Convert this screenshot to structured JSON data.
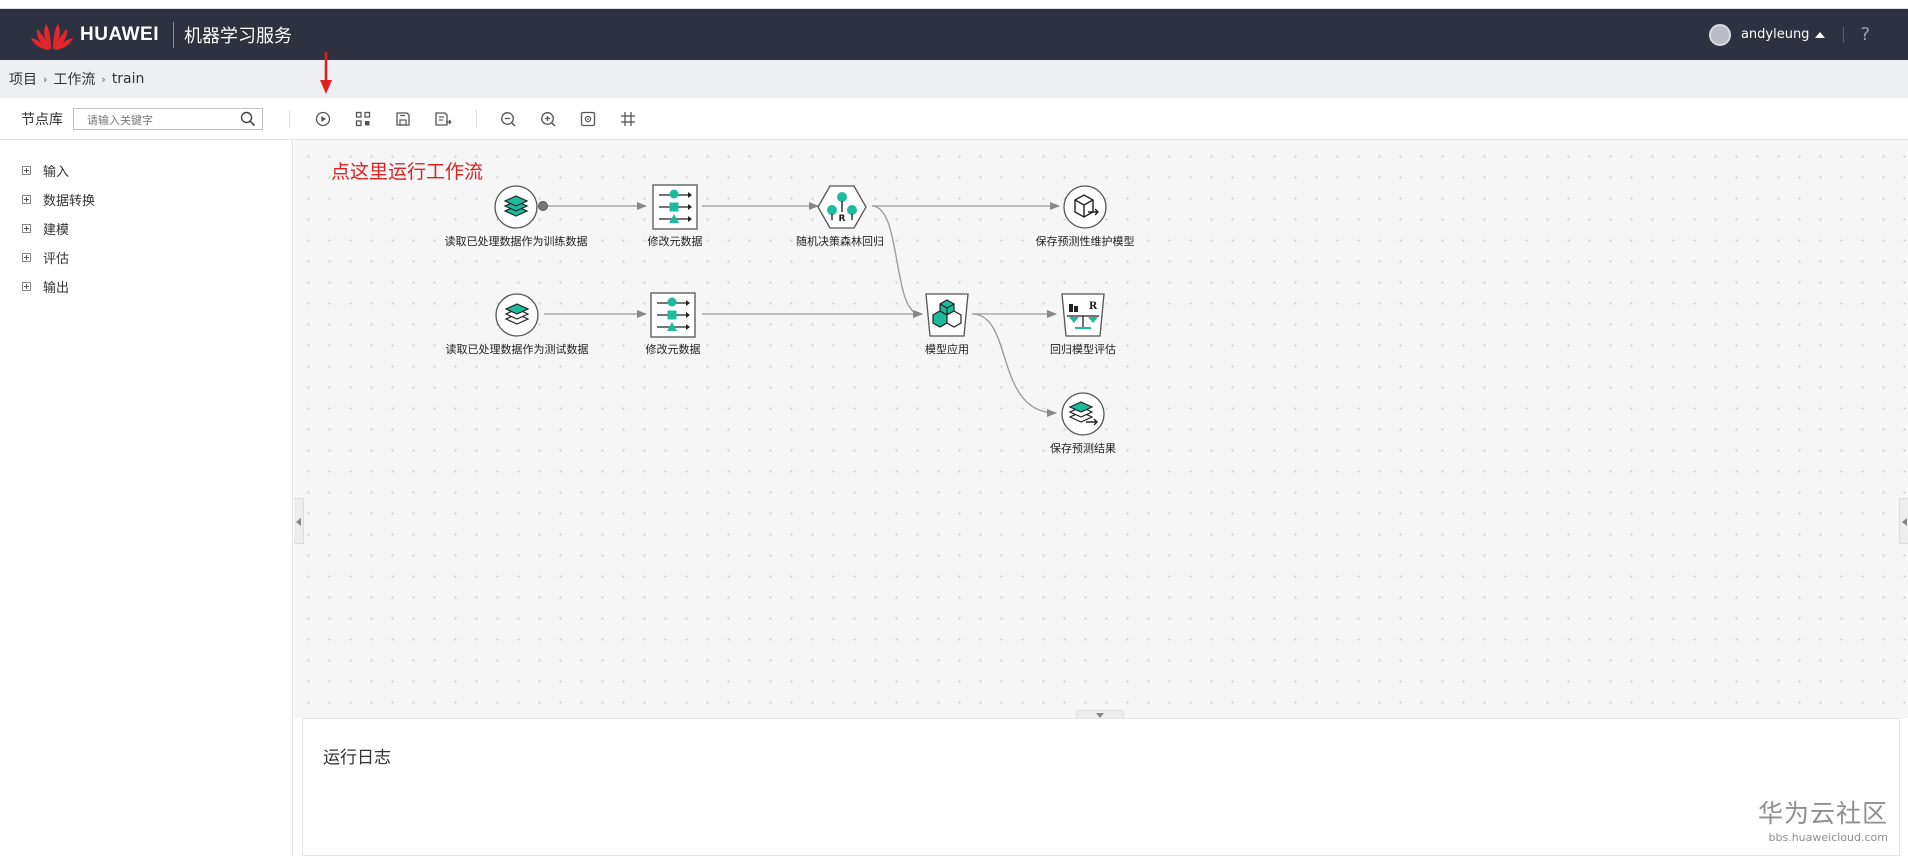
{
  "header": {
    "brand": "HUAWEI",
    "service": "机器学习服务",
    "username": "andyleung",
    "help": "?"
  },
  "breadcrumb": [
    "项目",
    "工作流",
    "train"
  ],
  "toolbar": {
    "library_label": "节点库",
    "search_placeholder": "请输入关键字",
    "buttons": [
      "run-icon",
      "layout-icon",
      "save-icon",
      "save-as-icon",
      "zoom-out-icon",
      "zoom-in-icon",
      "fit-icon",
      "grid-icon"
    ]
  },
  "sidebar": {
    "items": [
      {
        "label": "输入"
      },
      {
        "label": "数据转换"
      },
      {
        "label": "建模"
      },
      {
        "label": "评估"
      },
      {
        "label": "输出"
      }
    ]
  },
  "canvas": {
    "annotation": "点这里运行工作流",
    "nodes": [
      {
        "label": "读取已处理数据作为训练数据",
        "icon": "layers-icon"
      },
      {
        "label": "修改元数据",
        "icon": "metadata-icon"
      },
      {
        "label": "随机决策森林回归",
        "icon": "random-forest-icon"
      },
      {
        "label": "保存预测性维护模型",
        "icon": "save-model-icon"
      },
      {
        "label": "读取已处理数据作为测试数据",
        "icon": "layers-icon"
      },
      {
        "label": "修改元数据",
        "icon": "metadata-icon"
      },
      {
        "label": "模型应用",
        "icon": "model-apply-icon"
      },
      {
        "label": "回归模型评估",
        "icon": "regression-eval-icon"
      },
      {
        "label": "保存预测结果",
        "icon": "save-result-icon"
      }
    ]
  },
  "log": {
    "title": "运行日志"
  },
  "watermark": {
    "main": "华为云社区",
    "sub": "bbs.huaweicloud.com"
  },
  "colors": {
    "header_bg": "#2e3240",
    "accent_green": "#1abc9c",
    "annotation_red": "#e02020"
  }
}
